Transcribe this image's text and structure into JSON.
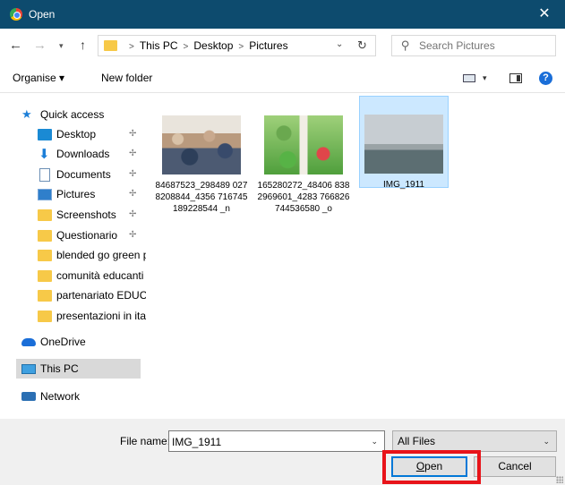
{
  "window": {
    "title": "Open",
    "close_glyph": "✕"
  },
  "address": {
    "crumbs": [
      "This PC",
      "Desktop",
      "Pictures"
    ],
    "search_placeholder": "Search Pictures"
  },
  "toolbar": {
    "organise": "Organise ▾",
    "new_folder": "New folder",
    "help": "?"
  },
  "sidebar": {
    "quick_access": "Quick access",
    "items": [
      {
        "label": "Desktop",
        "pinned": true
      },
      {
        "label": "Downloads",
        "pinned": true
      },
      {
        "label": "Documents",
        "pinned": true
      },
      {
        "label": "Pictures",
        "pinned": true
      },
      {
        "label": "Screenshots",
        "pinned": true
      },
      {
        "label": "Questionario",
        "pinned": true
      },
      {
        "label": "blended go green p",
        "pinned": false
      },
      {
        "label": "comunità educanti",
        "pinned": false
      },
      {
        "label": "partenariato EDUCC",
        "pinned": false
      },
      {
        "label": "presentazioni in ital",
        "pinned": false
      }
    ],
    "onedrive": "OneDrive",
    "this_pc": "This PC",
    "network": "Network"
  },
  "files": [
    {
      "name": "84687523_298489 0278208844_4356 716745189228544 _n",
      "selected": false
    },
    {
      "name": "165280272_48406 8382969601_4283 766826744536580 _o",
      "selected": false
    },
    {
      "name": "IMG_1911",
      "selected": true
    }
  ],
  "footer": {
    "file_name_label": "File name:",
    "file_name_value": "IMG_1911",
    "filter_value": "All Files",
    "open_label": "Open",
    "cancel_label": "Cancel"
  },
  "colors": {
    "titlebar": "#0d4b6e",
    "selection": "#cce8ff",
    "highlight_box": "#e8141a",
    "accent": "#0078d7"
  }
}
